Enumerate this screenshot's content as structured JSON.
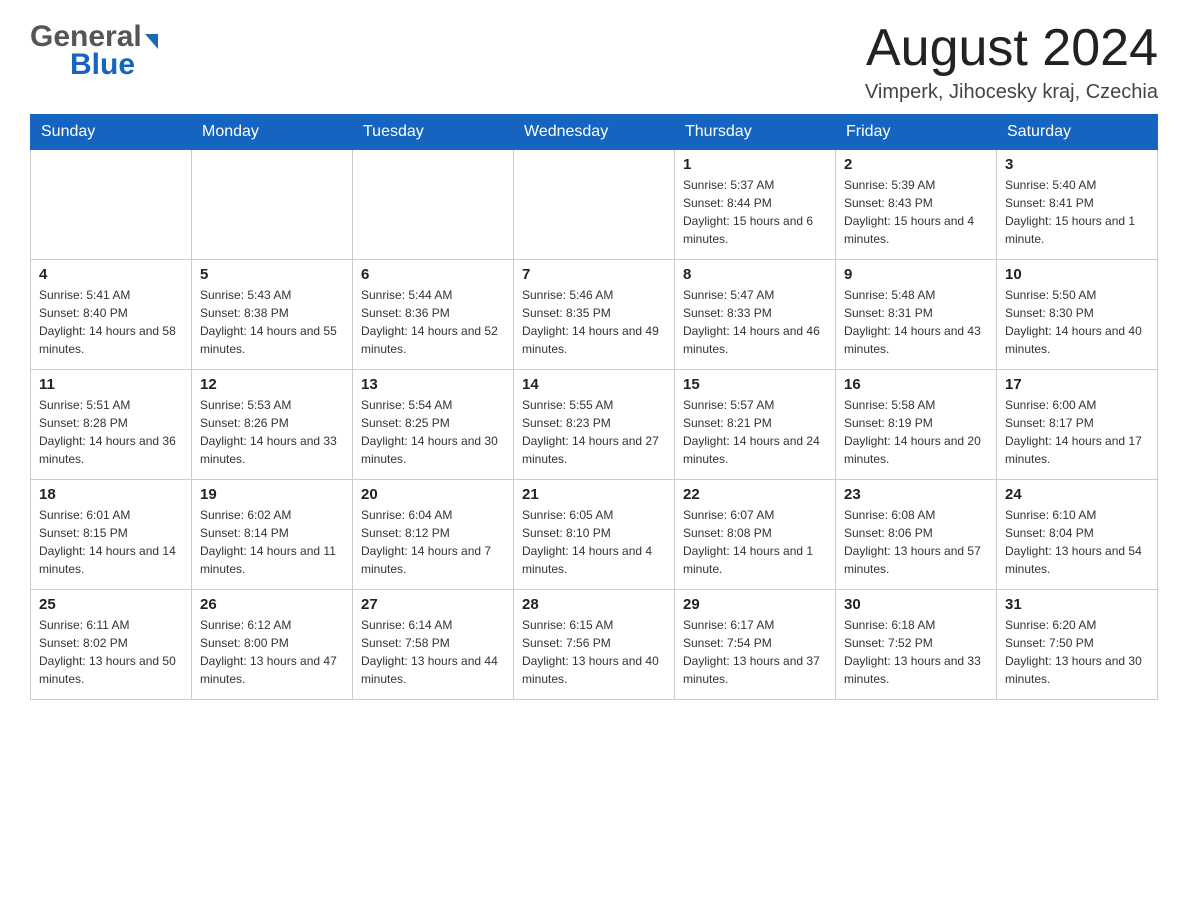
{
  "logo": {
    "line1": "General",
    "line2": "Blue"
  },
  "header": {
    "month_title": "August 2024",
    "location": "Vimperk, Jihocesky kraj, Czechia"
  },
  "days_of_week": [
    "Sunday",
    "Monday",
    "Tuesday",
    "Wednesday",
    "Thursday",
    "Friday",
    "Saturday"
  ],
  "weeks": [
    [
      {
        "day": "",
        "info": ""
      },
      {
        "day": "",
        "info": ""
      },
      {
        "day": "",
        "info": ""
      },
      {
        "day": "",
        "info": ""
      },
      {
        "day": "1",
        "info": "Sunrise: 5:37 AM\nSunset: 8:44 PM\nDaylight: 15 hours and 6 minutes."
      },
      {
        "day": "2",
        "info": "Sunrise: 5:39 AM\nSunset: 8:43 PM\nDaylight: 15 hours and 4 minutes."
      },
      {
        "day": "3",
        "info": "Sunrise: 5:40 AM\nSunset: 8:41 PM\nDaylight: 15 hours and 1 minute."
      }
    ],
    [
      {
        "day": "4",
        "info": "Sunrise: 5:41 AM\nSunset: 8:40 PM\nDaylight: 14 hours and 58 minutes."
      },
      {
        "day": "5",
        "info": "Sunrise: 5:43 AM\nSunset: 8:38 PM\nDaylight: 14 hours and 55 minutes."
      },
      {
        "day": "6",
        "info": "Sunrise: 5:44 AM\nSunset: 8:36 PM\nDaylight: 14 hours and 52 minutes."
      },
      {
        "day": "7",
        "info": "Sunrise: 5:46 AM\nSunset: 8:35 PM\nDaylight: 14 hours and 49 minutes."
      },
      {
        "day": "8",
        "info": "Sunrise: 5:47 AM\nSunset: 8:33 PM\nDaylight: 14 hours and 46 minutes."
      },
      {
        "day": "9",
        "info": "Sunrise: 5:48 AM\nSunset: 8:31 PM\nDaylight: 14 hours and 43 minutes."
      },
      {
        "day": "10",
        "info": "Sunrise: 5:50 AM\nSunset: 8:30 PM\nDaylight: 14 hours and 40 minutes."
      }
    ],
    [
      {
        "day": "11",
        "info": "Sunrise: 5:51 AM\nSunset: 8:28 PM\nDaylight: 14 hours and 36 minutes."
      },
      {
        "day": "12",
        "info": "Sunrise: 5:53 AM\nSunset: 8:26 PM\nDaylight: 14 hours and 33 minutes."
      },
      {
        "day": "13",
        "info": "Sunrise: 5:54 AM\nSunset: 8:25 PM\nDaylight: 14 hours and 30 minutes."
      },
      {
        "day": "14",
        "info": "Sunrise: 5:55 AM\nSunset: 8:23 PM\nDaylight: 14 hours and 27 minutes."
      },
      {
        "day": "15",
        "info": "Sunrise: 5:57 AM\nSunset: 8:21 PM\nDaylight: 14 hours and 24 minutes."
      },
      {
        "day": "16",
        "info": "Sunrise: 5:58 AM\nSunset: 8:19 PM\nDaylight: 14 hours and 20 minutes."
      },
      {
        "day": "17",
        "info": "Sunrise: 6:00 AM\nSunset: 8:17 PM\nDaylight: 14 hours and 17 minutes."
      }
    ],
    [
      {
        "day": "18",
        "info": "Sunrise: 6:01 AM\nSunset: 8:15 PM\nDaylight: 14 hours and 14 minutes."
      },
      {
        "day": "19",
        "info": "Sunrise: 6:02 AM\nSunset: 8:14 PM\nDaylight: 14 hours and 11 minutes."
      },
      {
        "day": "20",
        "info": "Sunrise: 6:04 AM\nSunset: 8:12 PM\nDaylight: 14 hours and 7 minutes."
      },
      {
        "day": "21",
        "info": "Sunrise: 6:05 AM\nSunset: 8:10 PM\nDaylight: 14 hours and 4 minutes."
      },
      {
        "day": "22",
        "info": "Sunrise: 6:07 AM\nSunset: 8:08 PM\nDaylight: 14 hours and 1 minute."
      },
      {
        "day": "23",
        "info": "Sunrise: 6:08 AM\nSunset: 8:06 PM\nDaylight: 13 hours and 57 minutes."
      },
      {
        "day": "24",
        "info": "Sunrise: 6:10 AM\nSunset: 8:04 PM\nDaylight: 13 hours and 54 minutes."
      }
    ],
    [
      {
        "day": "25",
        "info": "Sunrise: 6:11 AM\nSunset: 8:02 PM\nDaylight: 13 hours and 50 minutes."
      },
      {
        "day": "26",
        "info": "Sunrise: 6:12 AM\nSunset: 8:00 PM\nDaylight: 13 hours and 47 minutes."
      },
      {
        "day": "27",
        "info": "Sunrise: 6:14 AM\nSunset: 7:58 PM\nDaylight: 13 hours and 44 minutes."
      },
      {
        "day": "28",
        "info": "Sunrise: 6:15 AM\nSunset: 7:56 PM\nDaylight: 13 hours and 40 minutes."
      },
      {
        "day": "29",
        "info": "Sunrise: 6:17 AM\nSunset: 7:54 PM\nDaylight: 13 hours and 37 minutes."
      },
      {
        "day": "30",
        "info": "Sunrise: 6:18 AM\nSunset: 7:52 PM\nDaylight: 13 hours and 33 minutes."
      },
      {
        "day": "31",
        "info": "Sunrise: 6:20 AM\nSunset: 7:50 PM\nDaylight: 13 hours and 30 minutes."
      }
    ]
  ]
}
